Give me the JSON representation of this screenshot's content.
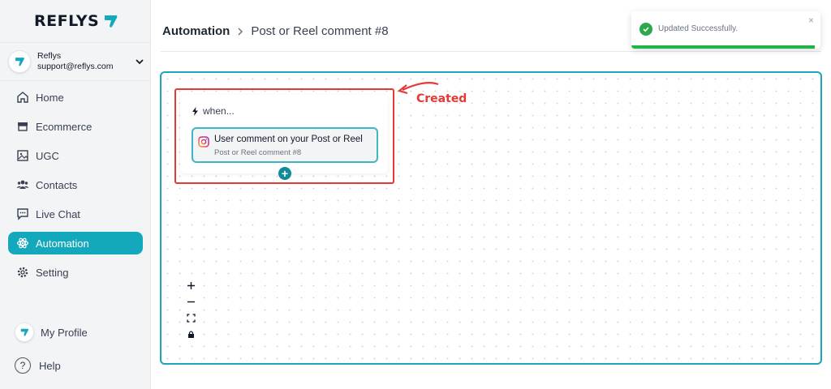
{
  "brand": {
    "name": "REFLYS",
    "accent": "#14a8bd"
  },
  "account": {
    "name": "Reflys",
    "email": "support@reflys.com"
  },
  "sidebar": {
    "items": [
      {
        "label": "Home",
        "icon": "home-icon"
      },
      {
        "label": "Ecommerce",
        "icon": "store-icon"
      },
      {
        "label": "UGC",
        "icon": "image-icon"
      },
      {
        "label": "Contacts",
        "icon": "users-icon"
      },
      {
        "label": "Live Chat",
        "icon": "chat-icon"
      },
      {
        "label": "Automation",
        "icon": "automation-icon",
        "active": true
      },
      {
        "label": "Setting",
        "icon": "gear-icon"
      }
    ],
    "profile_label": "My Profile",
    "help_label": "Help"
  },
  "breadcrumb": {
    "root": "Automation",
    "current": "Post or Reel comment #8"
  },
  "toast": {
    "message": "Updated Successfully.",
    "close": "×",
    "color": "#22b34a"
  },
  "flow": {
    "trigger_heading": "when...",
    "trigger_title": "User comment on your Post or Reel",
    "trigger_subtitle": "Post or Reel comment #8",
    "add_symbol": "+"
  },
  "annotation": {
    "label": "Created",
    "color": "#e53935"
  },
  "canvas_controls": [
    "zoom-in",
    "zoom-out",
    "fit-view",
    "lock"
  ]
}
